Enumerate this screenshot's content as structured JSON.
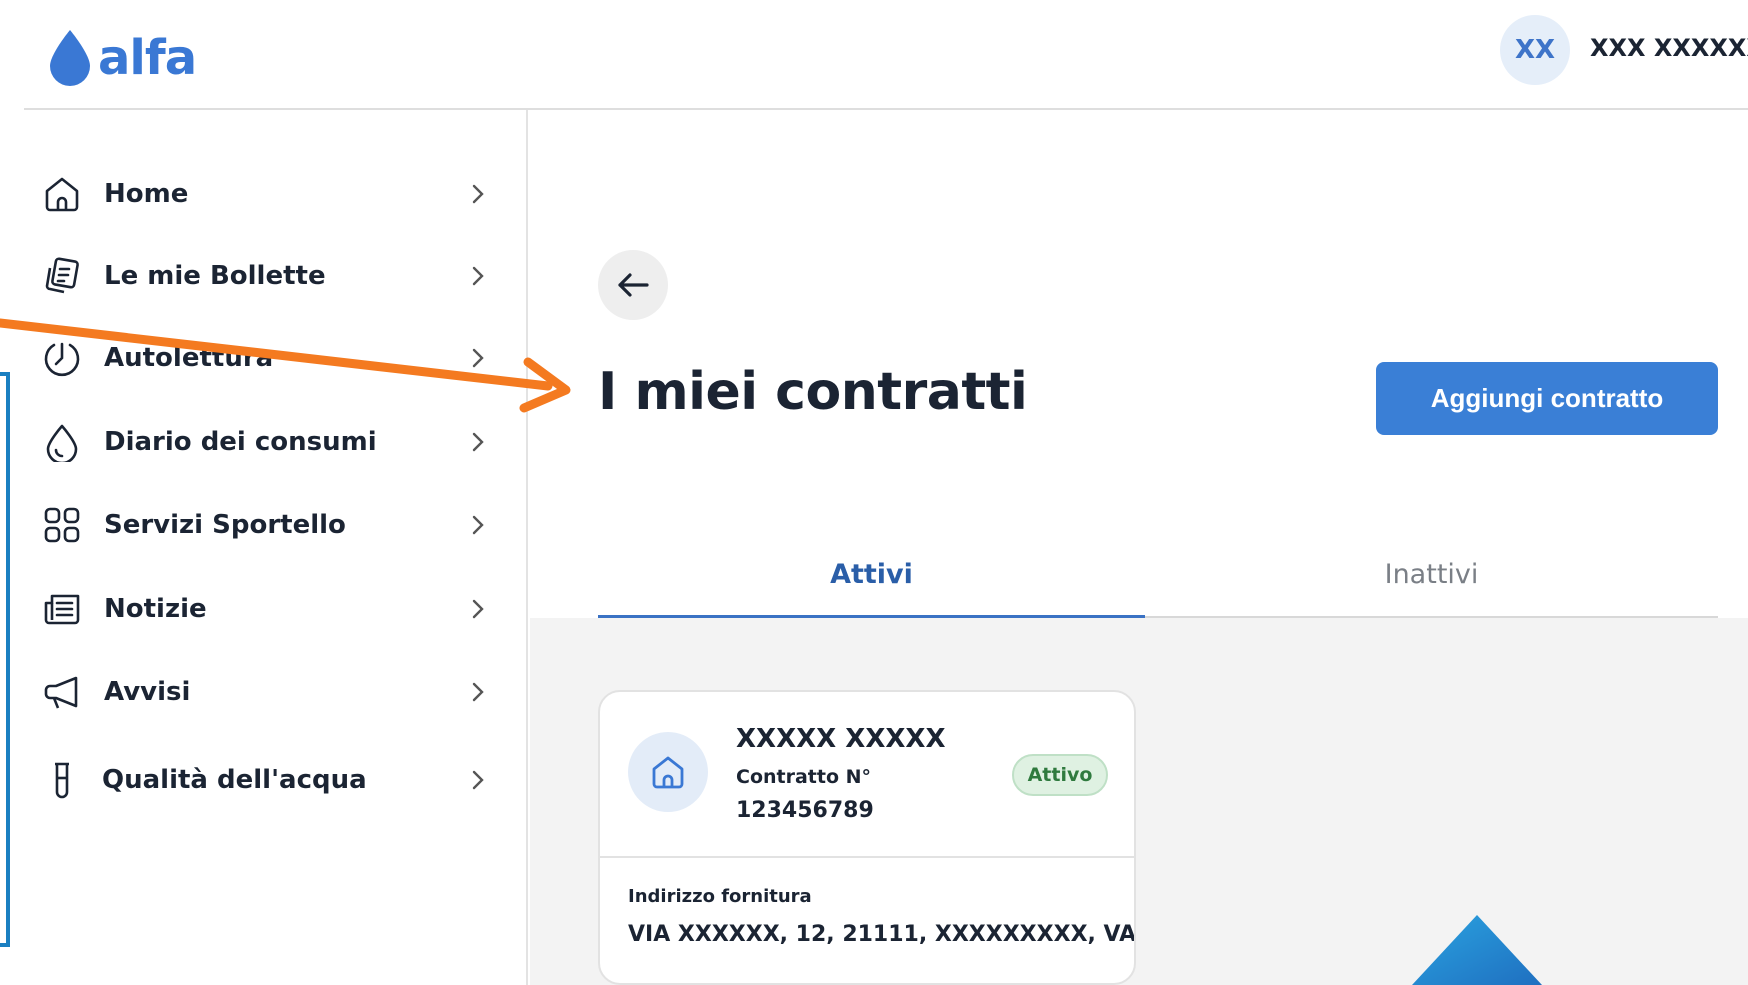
{
  "brand": {
    "logo_text": "alfa",
    "logo_icon": "water-drop-icon",
    "accent_color": "#3a78d4"
  },
  "user": {
    "initials": "XX",
    "name": "XXX XXXXXX"
  },
  "sidebar": {
    "items": [
      {
        "label": "Home",
        "icon": "home-icon"
      },
      {
        "label": "Le mie Bollette",
        "icon": "bills-icon"
      },
      {
        "label": "Autolettura",
        "icon": "meter-reading-icon"
      },
      {
        "label": "Diario dei consumi",
        "icon": "water-drop-outline-icon"
      },
      {
        "label": "Servizi Sportello",
        "icon": "grid-icon"
      },
      {
        "label": "Notizie",
        "icon": "newspaper-icon"
      },
      {
        "label": "Avvisi",
        "icon": "megaphone-icon"
      },
      {
        "label": "Qualità dell'acqua",
        "icon": "test-tube-icon"
      }
    ]
  },
  "main": {
    "back_icon": "arrow-left-icon",
    "title": "I miei contratti",
    "add_button_label": "Aggiungi contratto",
    "tabs": [
      {
        "label": "Attivi",
        "active": true
      },
      {
        "label": "Inattivi",
        "active": false
      }
    ]
  },
  "contracts": [
    {
      "holder": "XXXXX XXXXX",
      "contract_label": "Contratto N°",
      "contract_number": "123456789",
      "status": "Attivo",
      "status_color": "#2f7a3e",
      "address_label": "Indirizzo fornitura",
      "address": "VIA XXXXXX, 12, 21111, XXXXXXXXX, VA"
    }
  ],
  "annotation": {
    "arrow_color": "#f47a20",
    "box_color": "#1a7fc1"
  }
}
